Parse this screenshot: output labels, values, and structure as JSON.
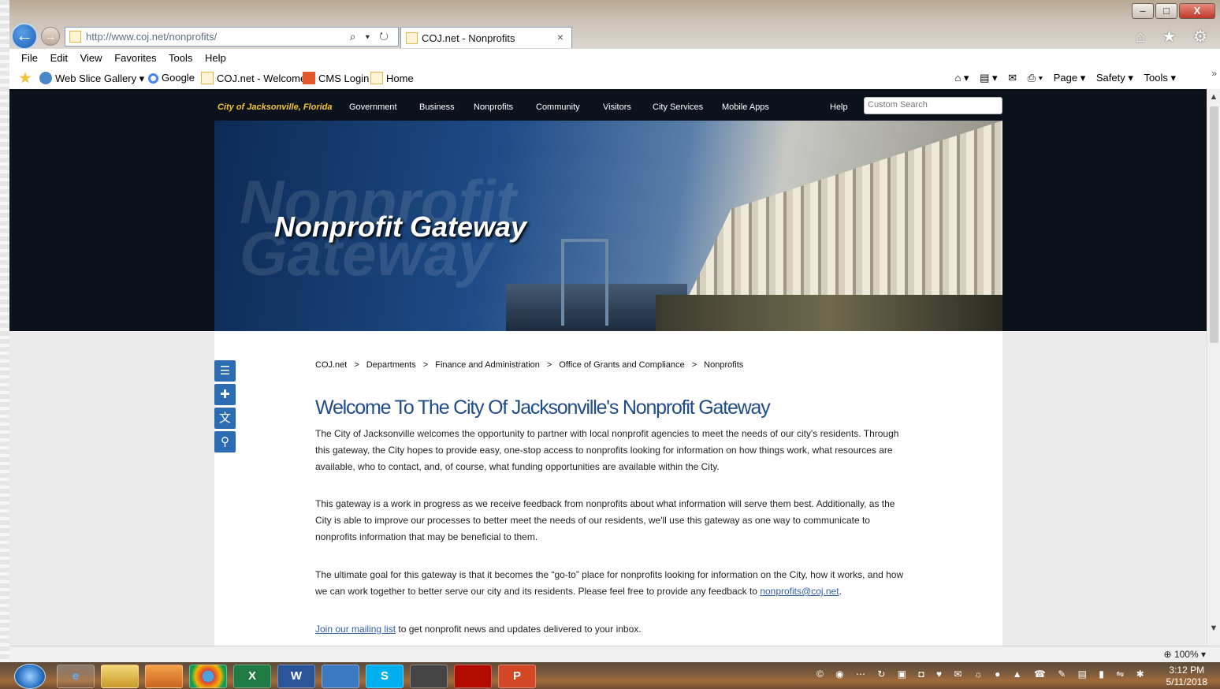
{
  "window": {
    "min_glyph": "–",
    "max_glyph": "□",
    "close_glyph": "X"
  },
  "browser": {
    "address_url": "http://www.coj.net/nonprofits/",
    "address_controls": "⌕ ▾ ↻",
    "tab_title": "COJ.net - Nonprofits",
    "tab_close": "×",
    "chrome_icons": "⌂ ★ ⚙",
    "menu": [
      "File",
      "Edit",
      "View",
      "Favorites",
      "Tools",
      "Help"
    ],
    "favorites": [
      "Web Slice Gallery ▾",
      "Google",
      "COJ.net - Welcome",
      "CMS Login",
      "Home"
    ],
    "command_bar": [
      "Page ▾",
      "Safety ▾",
      "Tools ▾"
    ],
    "overflow": "»",
    "zoom": "100%"
  },
  "site": {
    "brand": "City of Jacksonville, Florida",
    "nav": [
      "Government",
      "Business",
      "Nonprofits",
      "Community",
      "Visitors",
      "City Services",
      "Mobile Apps",
      "Help"
    ],
    "search_placeholder": "Custom Search",
    "banner_ghost_1": "Nonprofit",
    "banner_ghost_2": "Gateway",
    "banner_title": "Nonprofit Gateway",
    "breadcrumbs": [
      "COJ.net",
      "Departments",
      "Finance and Administration",
      "Office of Grants and Compliance",
      "Nonprofits"
    ],
    "crumb_sep": ">",
    "heading": "Welcome To The City Of Jacksonville's Nonprofit Gateway",
    "paragraphs": {
      "p1": "The City of Jacksonville welcomes the opportunity to partner with local nonprofit agencies to meet the needs of our city's residents. Through this gateway, the City hopes to provide easy, one-stop access to nonprofits looking for information on how things work, what resources are available, who to contact, and, of course, what funding opportunities are available within the City.",
      "p2": "This gateway is a work in progress as we receive feedback from nonprofits about what information will serve them best. Additionally, as the City is able to improve our processes to better meet the needs of our residents, we'll use this gateway as one way to communicate to nonprofits information that may be beneficial to them.",
      "p3_text": "The ultimate goal for this gateway is that it becomes the “go-to” place for nonprofits looking for information on the City, how it works, and how we can work together to better serve our city and its residents. Please feel free to provide any feedback to ",
      "p3_link": "nonprofits@coj.net",
      "p3_end": ".",
      "p4_link": "Join our mailing list",
      "p4_text": " to get nonprofit news and updates delivered to your inbox."
    }
  },
  "taskbar": {
    "apps": [
      "e",
      "",
      "",
      "",
      "X",
      "W",
      "",
      "S",
      "",
      "",
      "P"
    ],
    "tray_icons": "© ◉ ⋯ ↻ ▣ ◘ ♥ ✉ ☼ ● ▲ ☎ ✎ ▤ ▮ ⇋ ✱ ◀",
    "time": "3:12 PM",
    "date": "5/11/2018"
  }
}
